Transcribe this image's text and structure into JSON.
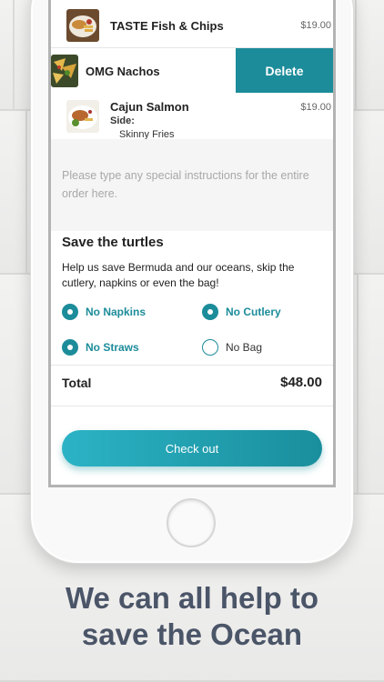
{
  "cart": {
    "items": [
      {
        "name": "TASTE Fish & Chips",
        "price": "$19.00"
      },
      {
        "name": "OMG  Nachos",
        "action": "Delete"
      },
      {
        "name": "Cajun Salmon",
        "price": "$19.00",
        "side_label": "Side:",
        "side_value": "Skinny Fries"
      }
    ]
  },
  "instructions": {
    "placeholder": "Please type any special instructions for the entire order  here."
  },
  "environment": {
    "title": "Save the turtles",
    "description": "Help us save Bermuda and our oceans, skip the cutlery, napkins or even the bag!",
    "options": [
      {
        "label": "No Napkins",
        "checked": true
      },
      {
        "label": "No Cutlery",
        "checked": true
      },
      {
        "label": "No Straws",
        "checked": true
      },
      {
        "label": "No Bag",
        "checked": false
      }
    ]
  },
  "total": {
    "label": "Total",
    "value": "$48.00"
  },
  "checkout": {
    "label": "Check out"
  },
  "colors": {
    "accent": "#1c8c9a",
    "tagline": "#4b5568"
  },
  "tagline": {
    "line1": "We can all help to",
    "line2": "save the Ocean"
  }
}
